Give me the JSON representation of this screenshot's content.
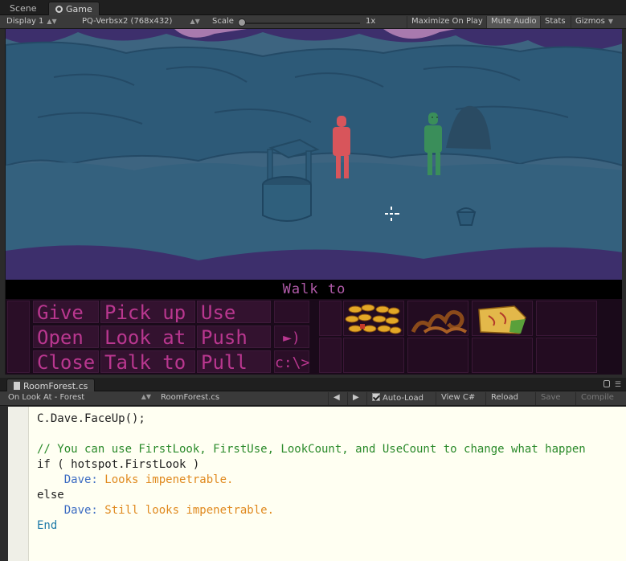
{
  "tabs": [
    {
      "label": "Scene",
      "active": false
    },
    {
      "label": "Game",
      "active": true
    }
  ],
  "game_toolbar": {
    "display": "Display 1",
    "resolution": "PQ-Verbsx2 (768x432)",
    "scale_label": "Scale",
    "scale_value": "1x",
    "buttons": [
      {
        "label": "Maximize On Play",
        "active": false
      },
      {
        "label": "Mute Audio",
        "active": true
      },
      {
        "label": "Stats",
        "active": false
      },
      {
        "label": "Gizmos",
        "active": false
      }
    ]
  },
  "game": {
    "verb_line": "Walk to",
    "verbs": [
      "Give",
      "Pick up",
      "Use",
      "Open",
      "Look at",
      "Push",
      "Close",
      "Talk to",
      "Pull"
    ],
    "side_glyphs": [
      "speaker-icon",
      "c:\\>"
    ],
    "inventory": [
      "coins",
      "rope",
      "map"
    ],
    "colors": {
      "sky": "#3d6480",
      "tree": "#2d5a78",
      "ground": "#34617e",
      "foliage_dark": "#3d2f6c",
      "verb_text": "#b9378f",
      "verb_line": "#b05aa8",
      "actor_red": "#d8555b",
      "actor_green": "#3a8e5a"
    }
  },
  "script": {
    "tab_label": "RoomForest.cs",
    "event_dropdown": "On Look At - Forest",
    "file_dropdown": "RoomForest.cs",
    "auto_load": "Auto-Load",
    "buttons": {
      "view": "View C#",
      "reload": "Reload",
      "save": "Save",
      "compile": "Compile"
    },
    "lines": [
      {
        "segs": [
          {
            "t": "C.Dave.FaceUp();",
            "c": "plain"
          }
        ]
      },
      {
        "segs": [
          {
            "t": "",
            "c": "plain"
          }
        ]
      },
      {
        "segs": [
          {
            "t": "// You can use FirstLook, FirstUse, LookCount, and UseCount to change what happen",
            "c": "comment"
          }
        ]
      },
      {
        "segs": [
          {
            "t": "if ( hotspot.FirstLook )",
            "c": "plain"
          }
        ]
      },
      {
        "segs": [
          {
            "t": "    ",
            "c": "plain"
          },
          {
            "t": "Dave:",
            "c": "actor"
          },
          {
            "t": " Looks impenetrable.",
            "c": "str"
          }
        ]
      },
      {
        "segs": [
          {
            "t": "else",
            "c": "plain"
          }
        ]
      },
      {
        "segs": [
          {
            "t": "    ",
            "c": "plain"
          },
          {
            "t": "Dave:",
            "c": "actor"
          },
          {
            "t": " Still looks impenetrable.",
            "c": "str"
          }
        ]
      },
      {
        "segs": [
          {
            "t": "End",
            "c": "kw"
          }
        ]
      }
    ]
  }
}
